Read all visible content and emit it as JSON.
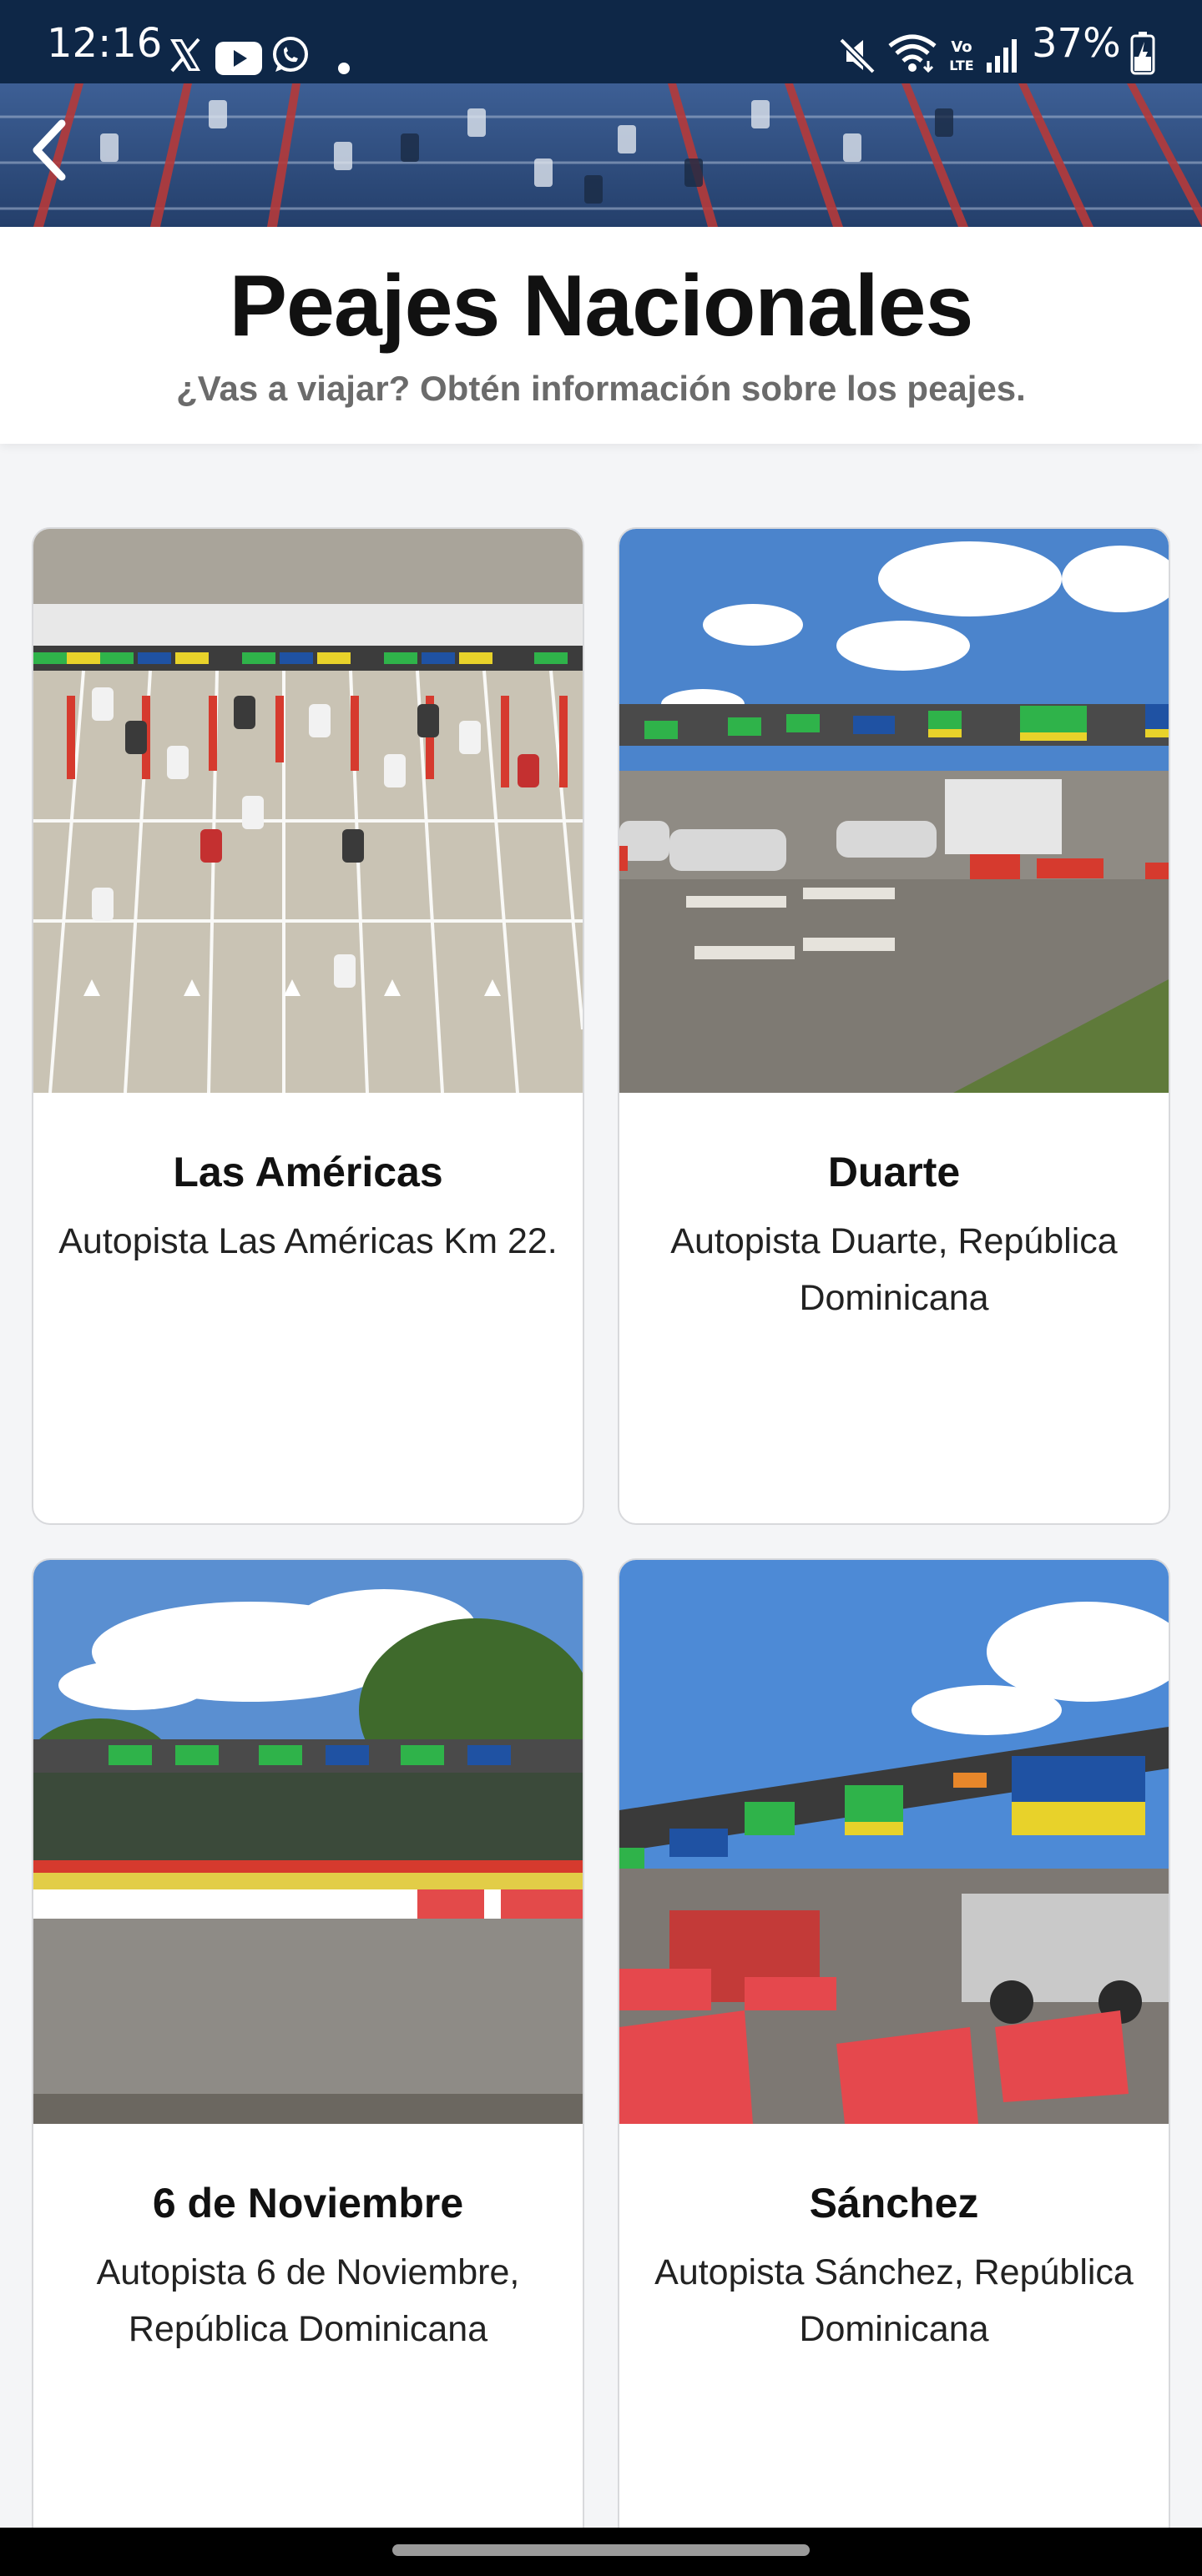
{
  "status_bar": {
    "time": "12:16",
    "battery": "37%",
    "notification_icons": [
      "x-icon",
      "youtube-icon",
      "whatsapp-icon",
      "dot-icon"
    ],
    "system_icons": [
      "mute-icon",
      "wifi-icon",
      "volte-icon",
      "signal-icon",
      "battery-icon"
    ]
  },
  "header": {
    "title": "Peajes Nacionales",
    "subtitle": "¿Vas a viajar? Obtén información sobre los peajes."
  },
  "tolls": [
    {
      "name": "Las Américas",
      "address": "Autopista Las Américas Km 22."
    },
    {
      "name": "Duarte",
      "address": "Autopista Duarte, República Dominicana"
    },
    {
      "name": "6 de Noviembre",
      "address": "Autopista 6 de Noviembre, República Dominicana"
    },
    {
      "name": "Sánchez",
      "address": "Autopista Sánchez, República Dominicana"
    }
  ],
  "colors": {
    "status_bar": "#0e2747",
    "page_background": "#f4f5f7",
    "title_text": "#111111",
    "subtitle_text": "#6b6b6b",
    "card_border": "#d8d9dc"
  }
}
